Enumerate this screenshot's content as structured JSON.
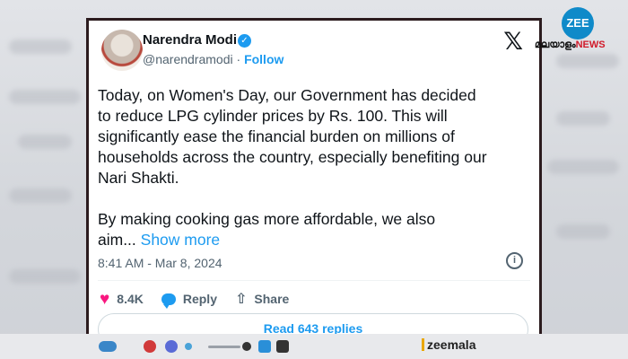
{
  "tweet": {
    "author_name": "Narendra Modi",
    "handle": "@narendramodi",
    "separator": " · ",
    "follow_label": "Follow",
    "x_logo": "𝕏",
    "text": "Today, on Women's Day, our Government has decided\nto reduce LPG cylinder prices by Rs. 100. This will\nsignificantly ease the financial burden on millions of\nhouseholds across the country, especially benefiting our\nNari Shakti.\n\nBy making cooking gas more affordable, we also\naim... ",
    "show_more": "Show more",
    "timestamp": "8:41 AM - Mar 8, 2024",
    "likes": "8.4K",
    "reply_label": "Reply",
    "share_label": "Share",
    "read_replies": "Read 643 replies"
  },
  "watermark": {
    "logo": "ZEE",
    "brand": "മലയാളം",
    "brand_suffix": "NEWS"
  },
  "bottom": {
    "label": "zeemala"
  },
  "colors": {
    "accent": "#1d9bf0",
    "like": "#f91880",
    "text": "#0f1419",
    "muted": "#536471"
  },
  "icons": [
    "verified-icon",
    "x-logo-icon",
    "info-icon",
    "heart-icon",
    "reply-icon",
    "share-icon",
    "zee-logo-icon"
  ]
}
